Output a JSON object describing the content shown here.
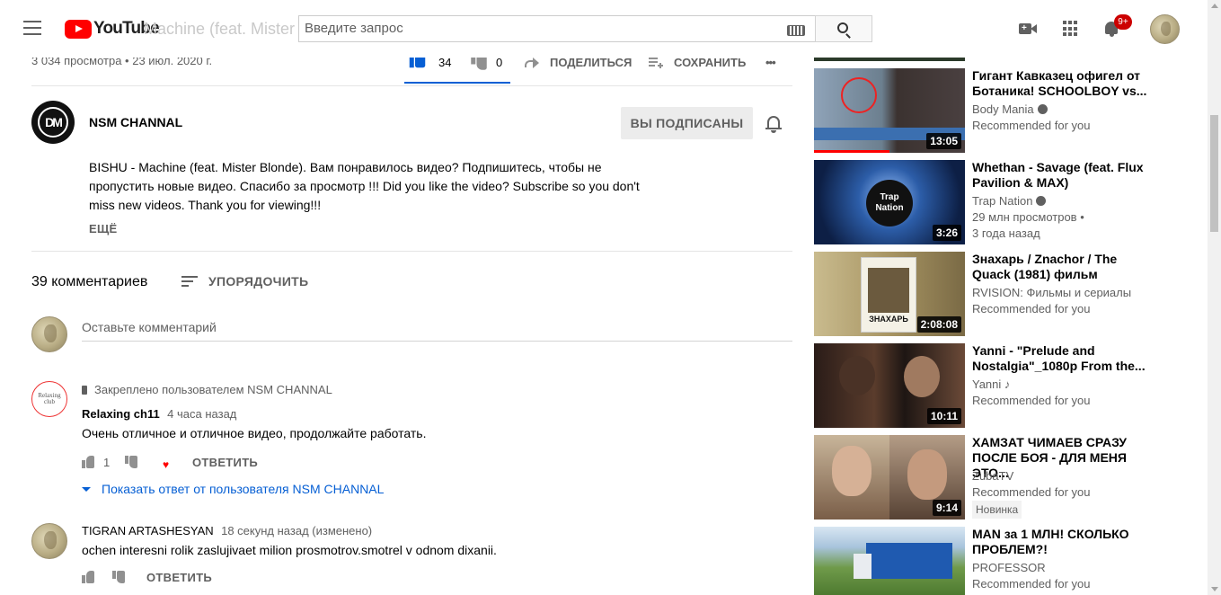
{
  "header": {
    "logo_text": "YouTube",
    "ghost_title": "Machine (feat. Mister Blonde)",
    "search_placeholder": "Введите запрос",
    "notifications_badge": "9+",
    "icons": [
      "menu-icon",
      "youtube-logo",
      "keyboard-icon",
      "search-icon",
      "create-video-icon",
      "apps-icon",
      "bell-icon",
      "avatar"
    ]
  },
  "video": {
    "views_date": "3 034 просмотра • 23 июл. 2020 г.",
    "likes": "34",
    "dislikes": "0",
    "share_label": "ПОДЕЛИТЬСЯ",
    "save_label": "СОХРАНИТЬ",
    "more_label": "•••"
  },
  "channel": {
    "logo_text": "DM",
    "name": "NSM CHANNAL",
    "subscribe_label": "ВЫ ПОДПИСАНЫ",
    "description": "BISHU - Machine (feat. Mister Blonde). Вам понравилось видео? Подпишитесь, чтобы не пропустить новые видео. Спасибо за просмотр !!! Did you like the video? Subscribe so you don't miss new videos. Thank you for viewing!!!",
    "more_label": "ЕЩЁ"
  },
  "comments": {
    "count_label": "39 комментариев",
    "sort_label": "УПОРЯДОЧИТЬ",
    "input_placeholder": "Оставьте комментарий",
    "items": [
      {
        "pinned_label": "Закреплено пользователем NSM CHANNAL",
        "avatar_text": "Relaxing club",
        "author": "Relaxing ch11",
        "time": "4 часа назад",
        "text": "Очень отличное и отличное видео, продолжайте работать.",
        "likes": "1",
        "reply_label": "ОТВЕТИТЬ",
        "show_reply_label": "Показать ответ от пользователя NSM CHANNAL"
      },
      {
        "author": "TIGRAN ARTASHESYAN",
        "time": "18 секунд назад (изменено)",
        "text": "ochen interesni rolik zaslujivaet milion prosmotrov.smotrel v odnom dixanii.",
        "reply_label": "ОТВЕТИТЬ"
      }
    ]
  },
  "sidebar": {
    "items": [
      {
        "title": "Гигант Кавказец офигел от Ботаника! SCHOOLBOY vs...",
        "channel": "Body Mania",
        "verified": true,
        "line2": "Recommended for you",
        "line3": "",
        "duration": "13:05",
        "thumb_color": "#5a6b78"
      },
      {
        "title": "Whethan - Savage (feat. Flux Pavilion & MAX)",
        "channel": "Trap Nation",
        "verified": true,
        "line2": "29 млн просмотров •",
        "line3": "3 года назад",
        "duration": "3:26",
        "thumb_color": "#1f3e73",
        "thumb_logo": "Trap Nation"
      },
      {
        "title": "Знахарь / Znachor / The Quack (1981) фильм",
        "channel": "RVISION: Фильмы и сериалы",
        "verified": false,
        "line2": "Recommended for you",
        "line3": "",
        "duration": "2:08:08",
        "thumb_color": "#8a7a55",
        "poster_text": "ЗНАХАРЬ"
      },
      {
        "title": "Yanni - \"Prelude and Nostalgia\"_1080p From the...",
        "channel": "Yanni",
        "verified": false,
        "music": "♪",
        "line2": "Recommended for you",
        "line3": "",
        "duration": "10:11",
        "thumb_color": "#3a2a22"
      },
      {
        "title": "ХАМЗАТ ЧИМАЕВ СРАЗУ ПОСЛЕ БОЯ - ДЛЯ МЕНЯ ЭТО...",
        "channel": "ZubaTV",
        "verified": false,
        "line2": "Recommended for you",
        "line3": "",
        "badge": "Новинка",
        "duration": "9:14",
        "thumb_color": "#6e5a4a"
      },
      {
        "title": "MAN за 1 МЛН! СКОЛЬКО ПРОБЛЕМ?!",
        "channel": "PROFESSOR",
        "verified": false,
        "line2": "Recommended for you",
        "line3": "",
        "duration": "",
        "thumb_color": "#6f9a4a"
      }
    ]
  }
}
